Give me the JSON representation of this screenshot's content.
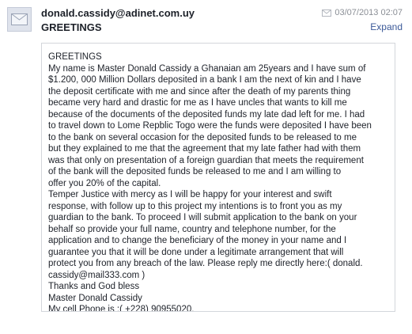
{
  "message": {
    "sender": "donald.cassidy@adinet.com.uy",
    "subject": "GREETINGS",
    "date": "03/07/2013 02:07",
    "expand_label": "Expand",
    "icons": {
      "avatar": "envelope-placeholder-icon",
      "status": "envelope-icon"
    },
    "colors": {
      "link": "#3b5998",
      "text": "#1d2129",
      "meta": "#8b8f96",
      "border": "#d3d6db"
    },
    "body_lines": [
      "GREETINGS",
      "My name is Master Donald Cassidy a Ghanaian am 25years and I have sum of",
      "$1.200, 000 Million Dollars deposited in a bank I am the next of kin and I have",
      "the deposit certificate with me and since after the death of my parents thing",
      "became very hard and drastic for me as I have uncles that wants to kill me",
      "because of the documents of the deposited funds my late dad left for me. I had",
      "to travel down to Lome Repblic Togo were the funds were deposited I have been",
      "to the bank on several occasion for the deposited funds to be released to me",
      "but they explained to me that the agreement that my late father had with them",
      "was that only on presentation of a foreign guardian that meets the requirement",
      "of the bank will the deposited funds be released to me and I am willing to",
      "offer you 20% of the capital.",
      "Temper Justice with mercy as I will be happy for your interest and swift",
      "response, with follow up to this project my intentions is to front you as my",
      "guardian to the bank. To proceed I will submit application to the bank on your",
      "behalf so provide your full name, country and telephone number, for the",
      "application and to change the beneficiary of the money in your name and I",
      "guarantee you that it will be done under a legitimate arrangement that will",
      "protect you from any breach of the law. Please reply me directly here:( donald.",
      "cassidy@mail333.com    )",
      "Thanks and God bless",
      "Master Donald Cassidy",
      "My cell Phone is :( +228) 90955020."
    ]
  }
}
